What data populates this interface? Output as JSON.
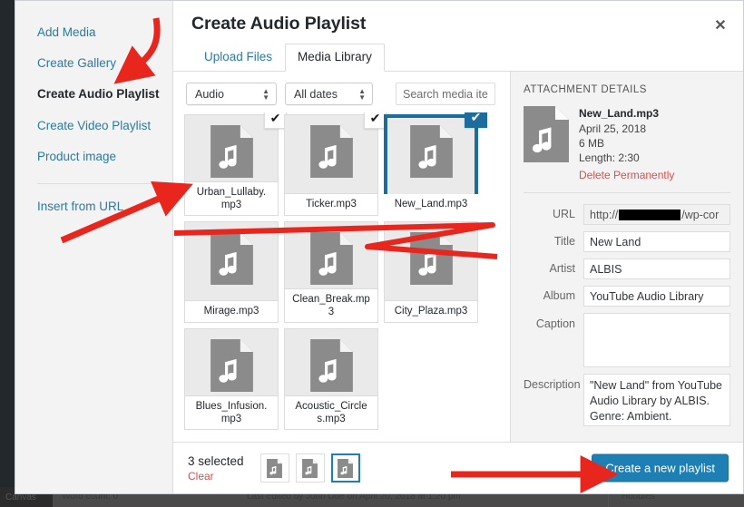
{
  "window": {
    "modal_title": "Create Audio Playlist",
    "close_label": "✕"
  },
  "menu": {
    "items": [
      {
        "label": "Add Media",
        "active": false
      },
      {
        "label": "Create Gallery",
        "active": false
      },
      {
        "label": "Create Audio Playlist",
        "active": true
      },
      {
        "label": "Create Video Playlist",
        "active": false
      },
      {
        "label": "Product image",
        "active": false
      }
    ],
    "secondary": [
      {
        "label": "Insert from URL"
      }
    ]
  },
  "tabs": [
    {
      "label": "Upload Files",
      "active": false
    },
    {
      "label": "Media Library",
      "active": true
    }
  ],
  "filters": {
    "type_filter": "Audio",
    "date_filter": "All dates",
    "search_placeholder": "Search media items",
    "search_value": ""
  },
  "grid": {
    "items": [
      {
        "filename": "Urban_Lullaby.mp3",
        "label_line1": "Urban_Lullaby.",
        "label_line2": "mp3",
        "checked": true,
        "selected": false
      },
      {
        "filename": "Ticker.mp3",
        "label_line1": "Ticker.mp3",
        "label_line2": "",
        "checked": true,
        "selected": false
      },
      {
        "filename": "New_Land.mp3",
        "label_line1": "New_Land.mp3",
        "label_line2": "",
        "checked": true,
        "selected": true
      },
      {
        "filename": "Mirage.mp3",
        "label_line1": "Mirage.mp3",
        "label_line2": "",
        "checked": false,
        "selected": false
      },
      {
        "filename": "Clean_Break.mp3",
        "label_line1": "Clean_Break.mp",
        "label_line2": "3",
        "checked": false,
        "selected": false
      },
      {
        "filename": "City_Plaza.mp3",
        "label_line1": "City_Plaza.mp3",
        "label_line2": "",
        "checked": false,
        "selected": false
      },
      {
        "filename": "Blues_Infusion.mp3",
        "label_line1": "Blues_Infusion.",
        "label_line2": "mp3",
        "checked": false,
        "selected": false
      },
      {
        "filename": "Acoustic_Circles.mp3",
        "label_line1": "Acoustic_Circle",
        "label_line2": "s.mp3",
        "checked": false,
        "selected": false
      }
    ],
    "checkmark_glyph": "✔"
  },
  "attachment": {
    "heading": "ATTACHMENT DETAILS",
    "filename": "New_Land.mp3",
    "date": "April 25, 2018",
    "filesize": "6 MB",
    "length": "Length: 2:30",
    "delete_label": "Delete Permanently",
    "fields": {
      "url_label": "URL",
      "url_prefix": "http://",
      "url_suffix": "/wp-cor",
      "title_label": "Title",
      "title_value": "New Land",
      "artist_label": "Artist",
      "artist_value": "ALBIS",
      "album_label": "Album",
      "album_value": "YouTube Audio Library",
      "caption_label": "Caption",
      "caption_value": "",
      "description_label": "Description",
      "description_value": "\"New Land\" from YouTube Audio Library by ALBIS. Genre: Ambient."
    }
  },
  "footer": {
    "selected_count": "3 selected",
    "clear_label": "Clear",
    "thumbs": [
      {
        "name": "Urban_Lullaby.mp3",
        "active": false
      },
      {
        "name": "Ticker.mp3",
        "active": false
      },
      {
        "name": "New_Land.mp3",
        "active": true
      }
    ],
    "primary_button": "Create a new playlist"
  },
  "background": {
    "cells": [
      "Canvas",
      "Word count: 0",
      "Last edited by John Doe on April 20, 2018 at 1:20 pm",
      "Hoodies"
    ]
  },
  "colors": {
    "accent_blue": "#1d7fb3",
    "selection_blue": "#1d6d9c",
    "link_blue": "#2a7aa5",
    "danger_red": "#d94f4f",
    "annotation_red": "#e8261d"
  }
}
